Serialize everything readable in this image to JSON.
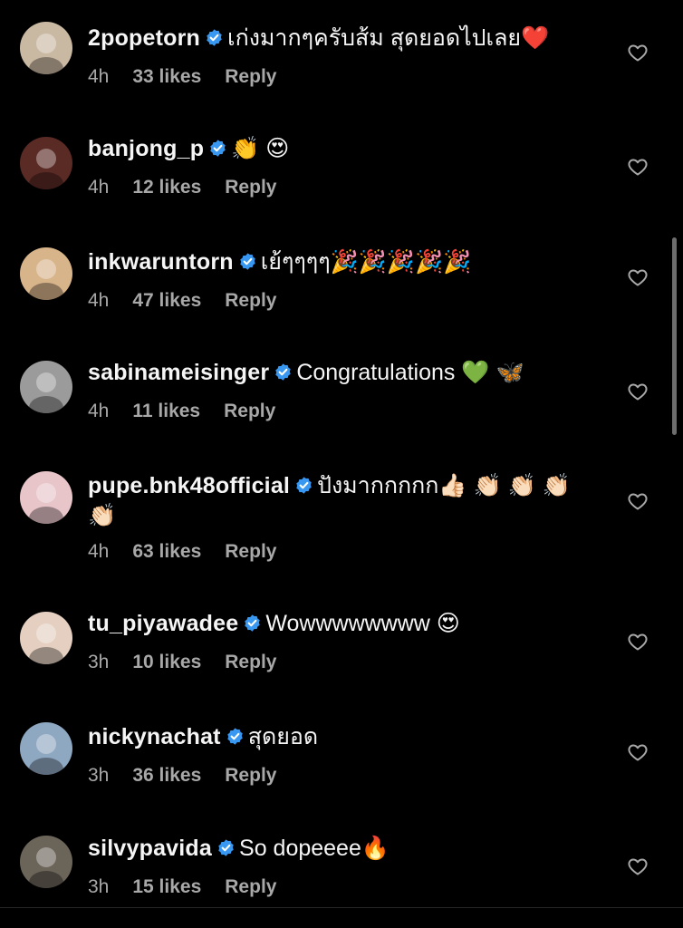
{
  "comments": [
    {
      "username": "2popetorn",
      "text": "เก่งมากๆครับส้ม สุดยอดไปเลย❤️",
      "time": "4h",
      "likes": "33 likes",
      "reply": "Reply",
      "avatar_color": "#c9b9a3"
    },
    {
      "username": "banjong_p",
      "text": "👏 😍",
      "time": "4h",
      "likes": "12 likes",
      "reply": "Reply",
      "avatar_color": "#5a2a25"
    },
    {
      "username": "inkwaruntorn",
      "text": "เย้ๆๆๆๆ🎉🎉🎉🎉🎉",
      "time": "4h",
      "likes": "47 likes",
      "reply": "Reply",
      "avatar_color": "#d8b48a"
    },
    {
      "username": "sabinameisinger",
      "text": "Congratulations 💚 🦋",
      "time": "4h",
      "likes": "11 likes",
      "reply": "Reply",
      "avatar_color": "#9b9b9b"
    },
    {
      "username": "pupe.bnk48official",
      "text": "ปังมากกกกก👍🏻 👏🏻 👏🏻 👏🏻 👏🏻",
      "time": "4h",
      "likes": "63 likes",
      "reply": "Reply",
      "avatar_color": "#e8c5c9"
    },
    {
      "username": "tu_piyawadee",
      "text": "Wowwwwwwww 😍",
      "time": "3h",
      "likes": "10 likes",
      "reply": "Reply",
      "avatar_color": "#e4cfc0"
    },
    {
      "username": "nickynachat",
      "text": "สุดยอด",
      "time": "3h",
      "likes": "36 likes",
      "reply": "Reply",
      "avatar_color": "#8fa8c2"
    },
    {
      "username": "silvypavida",
      "text": "So dopeeee🔥",
      "time": "3h",
      "likes": "15 likes",
      "reply": "Reply",
      "avatar_color": "#6b6459"
    }
  ],
  "icons": {
    "verified": "verified-badge-icon",
    "like": "heart-outline-icon"
  },
  "colors": {
    "background": "#000000",
    "primary_text": "#f5f5f5",
    "secondary_text": "#a8a8a8",
    "verified_blue": "#3897f0"
  }
}
